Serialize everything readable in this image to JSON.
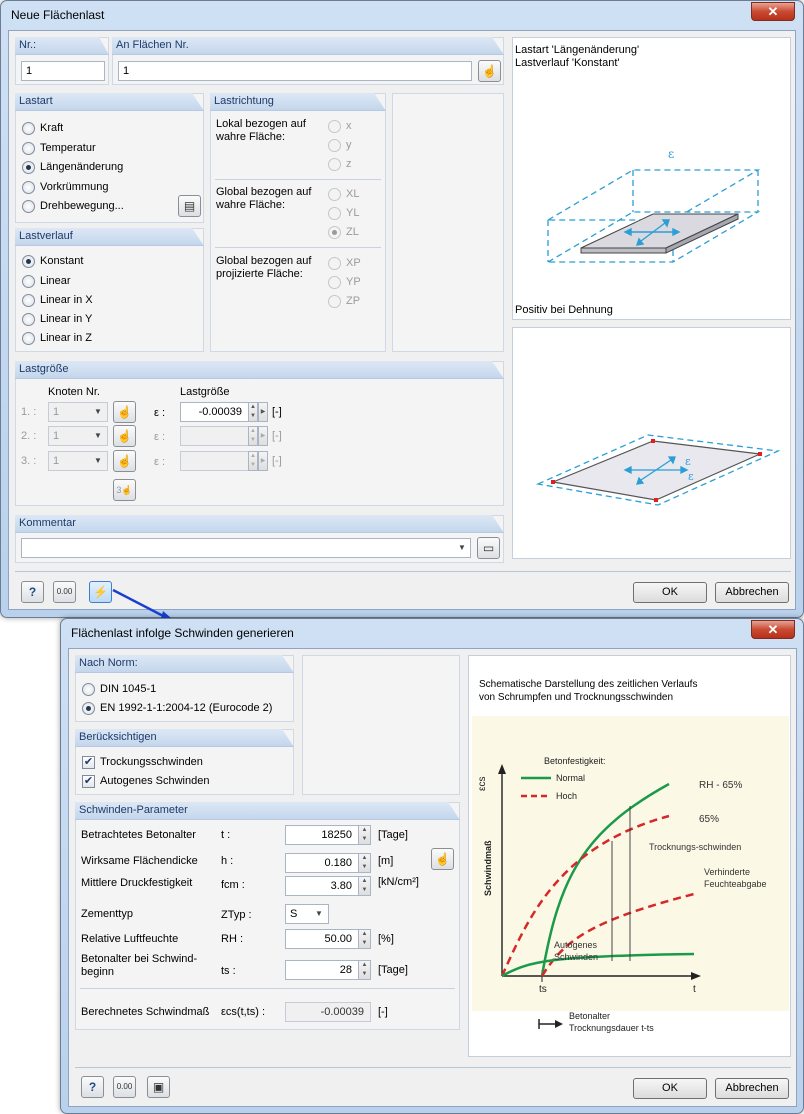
{
  "dialog1": {
    "title": "Neue Flächenlast",
    "close": "✕",
    "nr": {
      "label": "Nr.:",
      "value": "1"
    },
    "flaechen": {
      "label": "An Flächen Nr.",
      "value": "1"
    },
    "lastart": {
      "label": "Lastart",
      "options": [
        "Kraft",
        "Temperatur",
        "Längenänderung",
        "Vorkrümmung",
        "Drehbewegung..."
      ],
      "selected": "Längenänderung"
    },
    "lastrichtung": {
      "label": "Lastrichtung",
      "lokal": "Lokal bezogen auf wahre Fläche:",
      "lokal_opts": [
        "x",
        "y",
        "z"
      ],
      "global_wahr": "Global bezogen auf wahre Fläche:",
      "global_wahr_opts": [
        "XL",
        "YL",
        "ZL"
      ],
      "global_proj": "Global bezogen auf projizierte Fläche:",
      "global_proj_opts": [
        "XP",
        "YP",
        "ZP"
      ],
      "selected": "ZL"
    },
    "lastverlauf": {
      "label": "Lastverlauf",
      "options": [
        "Konstant",
        "Linear",
        "Linear in X",
        "Linear in Y",
        "Linear in Z"
      ],
      "selected": "Konstant"
    },
    "lastgroesse": {
      "label": "Lastgröße",
      "knoten_header": "Knoten Nr.",
      "value_header": "Lastgröße",
      "rows": [
        {
          "idx": "1. :",
          "knoten": "1",
          "sym": "ε :",
          "value": "-0.00039",
          "unit": "[-]"
        },
        {
          "idx": "2. :",
          "knoten": "1",
          "sym": "ε :",
          "value": "",
          "unit": "[-]"
        },
        {
          "idx": "3. :",
          "knoten": "1",
          "sym": "ε :",
          "value": "",
          "unit": "[-]"
        }
      ]
    },
    "kommentar": {
      "label": "Kommentar",
      "value": ""
    },
    "preview_top": {
      "line1": "Lastart 'Längenänderung'",
      "line2": "Lastverlauf 'Konstant'",
      "footer": "Positiv bei Dehnung",
      "symbol": "ε"
    },
    "preview_bottom": {
      "symbol": "ε"
    },
    "buttons": {
      "ok": "OK",
      "cancel": "Abbrechen",
      "units": "0.00"
    }
  },
  "dialog2": {
    "title": "Flächenlast infolge Schwinden generieren",
    "close": "✕",
    "norm": {
      "label": "Nach Norm:",
      "options": [
        "DIN 1045-1",
        "EN 1992-1-1:2004-12 (Eurocode 2)"
      ],
      "selected": "EN 1992-1-1:2004-12 (Eurocode 2)"
    },
    "beruecksichtigen": {
      "label": "Berücksichtigen",
      "items": [
        {
          "label": "Trockungsschwinden",
          "checked": true
        },
        {
          "label": "Autogenes Schwinden",
          "checked": true
        }
      ]
    },
    "parameter": {
      "label": "Schwinden-Parameter",
      "rows": [
        {
          "label": "Betrachtetes Betonalter",
          "sym": "t :",
          "value": "18250",
          "unit": "[Tage]"
        },
        {
          "label": "Wirksame Flächendicke",
          "sym": "h :",
          "value": "0.180",
          "unit": "[m]"
        },
        {
          "label": "Mittlere Druckfestigkeit",
          "sym": "fcm :",
          "value": "3.80",
          "unit": "[kN/cm²]"
        },
        {
          "label": "Zementtyp",
          "sym": "ZTyp :",
          "value": "S",
          "unit": ""
        },
        {
          "label": "Relative Luftfeuchte",
          "sym": "RH :",
          "value": "50.00",
          "unit": "[%]"
        },
        {
          "label": "Betonalter bei Schwind-beginn",
          "sym": "ts :",
          "value": "28",
          "unit": "[Tage]"
        }
      ],
      "result": {
        "label": "Berechnetes Schwindmaß",
        "sym": "εcs(t,ts) :",
        "value": "-0.00039",
        "unit": "[-]"
      }
    },
    "diagram": {
      "caption1": "Schematische Darstellung des zeitlichen Verlaufs",
      "caption2": "von Schrumpfen und Trocknungsschwinden",
      "legend_title": "Betonfestigkeit:",
      "legend_normal": "Normal",
      "legend_hoch": "Hoch",
      "y_axis": "εcs",
      "y_label": "Schwindmaß",
      "label_rh65": "RH - 65%",
      "label_65": "65%",
      "label_trocknung": "Trocknungs-schwinden",
      "label_verhindert1": "Verhinderte",
      "label_verhindert2": "Feuchteabgabe",
      "label_autogen1": "Autogenes",
      "label_autogen2": "Schwinden",
      "x_ts": "ts",
      "x_t": "t",
      "footer1": "Betonalter",
      "footer2": "Trocknungsdauer t-ts",
      "color_normal": "#1b9a4a",
      "color_hoch": "#d62828"
    },
    "buttons": {
      "ok": "OK",
      "cancel": "Abbrechen",
      "units": "0.00"
    }
  }
}
